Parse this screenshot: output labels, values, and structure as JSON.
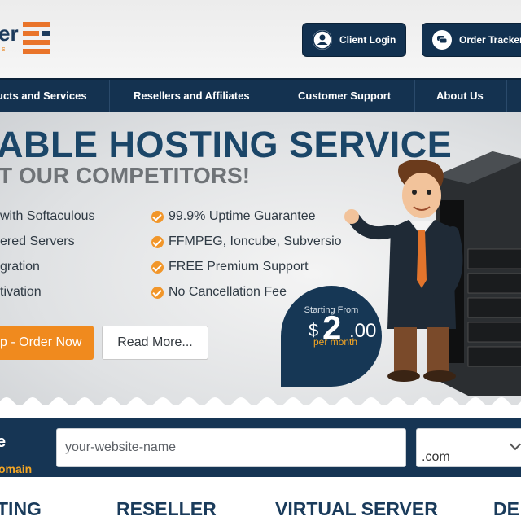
{
  "header": {
    "logo_text": "er",
    "logo_sub": "s",
    "client_login": "Client Login",
    "order_tracker": "Order Tracker"
  },
  "nav": {
    "items": [
      {
        "label": "ucts and Services"
      },
      {
        "label": "Resellers and Affiliates"
      },
      {
        "label": "Customer Support"
      },
      {
        "label": "About Us"
      }
    ]
  },
  "hero": {
    "title": "ABLE HOSTING SERVICE",
    "subtitle": "T OUR COMPETITORS!",
    "features_left": [
      " with Softaculous",
      "ered Servers",
      "gration",
      "tivation"
    ],
    "features_right": [
      "99.9% Uptime Guarantee",
      "FFMPEG, Ioncube, Subversio",
      "FREE Premium Support",
      "No Cancellation Fee"
    ],
    "order_button": "p - Order Now",
    "read_more": "Read More...",
    "price": {
      "label": "Starting From",
      "currency": "$",
      "integer": "2",
      "decimal": ".00",
      "per": "per month"
    }
  },
  "domain": {
    "title": "e",
    "subtitle": "omain",
    "placeholder": "your-website-name",
    "tld": ".com"
  },
  "tabs": [
    "TING",
    "RESELLER",
    "VIRTUAL SERVER",
    "DE"
  ],
  "colors": {
    "navy": "#143250",
    "orange": "#f08a1e",
    "title_blue": "#1b4668"
  }
}
